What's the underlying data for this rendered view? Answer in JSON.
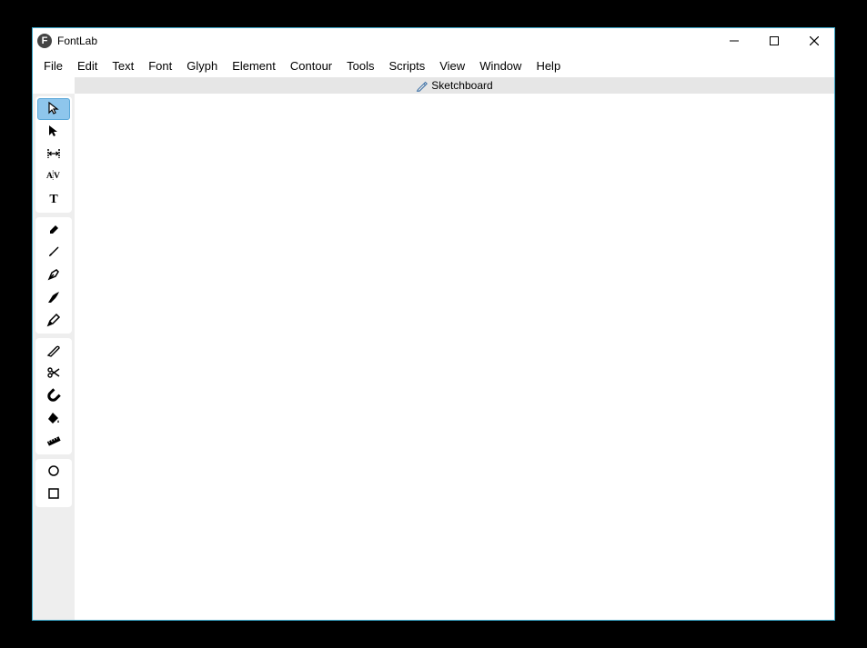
{
  "app": {
    "title": "FontLab",
    "icon_letter": "F"
  },
  "menu": {
    "items": [
      "File",
      "Edit",
      "Text",
      "Font",
      "Glyph",
      "Element",
      "Contour",
      "Tools",
      "Scripts",
      "View",
      "Window",
      "Help"
    ]
  },
  "tab": {
    "label": "Sketchboard"
  },
  "tools": {
    "group1": [
      {
        "name": "cursor-arrow-outline",
        "selected": true
      },
      {
        "name": "cursor-arrow-solid",
        "selected": false
      },
      {
        "name": "spacing",
        "selected": false
      },
      {
        "name": "kerning-av",
        "selected": false
      },
      {
        "name": "text-t",
        "selected": false
      }
    ],
    "group2": [
      {
        "name": "eraser",
        "selected": false
      },
      {
        "name": "brush",
        "selected": false
      },
      {
        "name": "pen-nib",
        "selected": false
      },
      {
        "name": "rapid",
        "selected": false
      },
      {
        "name": "pencil",
        "selected": false
      }
    ],
    "group3": [
      {
        "name": "knife",
        "selected": false
      },
      {
        "name": "scissors",
        "selected": false
      },
      {
        "name": "magnet",
        "selected": false
      },
      {
        "name": "fill-bucket",
        "selected": false
      },
      {
        "name": "ruler",
        "selected": false
      }
    ],
    "group4": [
      {
        "name": "ellipse",
        "selected": false
      },
      {
        "name": "rectangle",
        "selected": false
      }
    ]
  }
}
